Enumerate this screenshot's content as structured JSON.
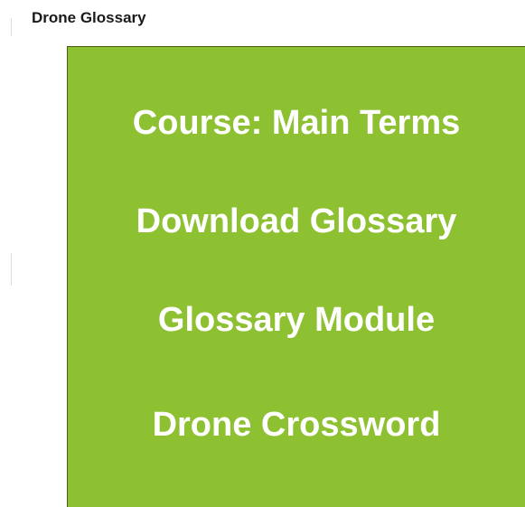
{
  "page": {
    "title": "Drone Glossary"
  },
  "menu": {
    "background_color": "#8dc132",
    "text_color": "#ffffff",
    "links": [
      {
        "label": "Course: Main Terms"
      },
      {
        "label": "Download Glossary"
      },
      {
        "label": "Glossary Module"
      },
      {
        "label": "Drone Crossword"
      }
    ]
  }
}
